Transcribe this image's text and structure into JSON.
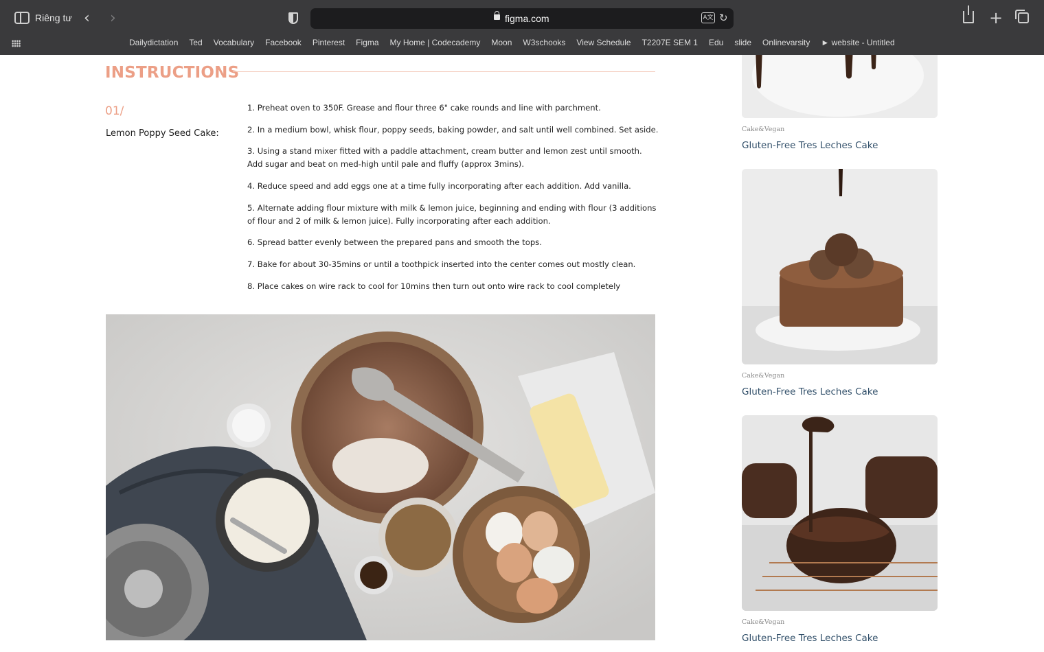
{
  "browser": {
    "profile_label": "Riêng tư",
    "url": "figma.com",
    "bookmarks": [
      "Dailydictation",
      "Ted",
      "Vocabulary",
      "Facebook",
      "Pinterest",
      "Figma",
      "My Home | Codecademy",
      "Moon",
      "W3schooks",
      "View Schedule",
      "T2207E SEM 1",
      "Edu",
      "slide",
      "Onlinevarsity",
      "► website - Untitled"
    ]
  },
  "instructions": {
    "title": "INSTRUCTIONS",
    "step_number": "01/",
    "step_heading": "Lemon Poppy Seed Cake:",
    "steps": [
      "1. Preheat oven to 350F. Grease and flour three 6\" cake rounds and line with parchment.",
      "2. In a medium bowl, whisk flour, poppy seeds, baking powder, and salt until well combined. Set aside.",
      "3. Using a stand mixer fitted with a paddle attachment, cream butter and lemon zest until smooth. Add sugar and beat on med-high until pale and fluffy (approx 3mins).",
      "4. Reduce speed and add eggs one at a time fully incorporating after each addition. Add vanilla.",
      "5. Alternate adding flour mixture with milk & lemon juice, beginning and ending with flour (3 additions of flour and 2 of milk & lemon juice). Fully incorporating after each addition.",
      "6. Spread batter evenly between the prepared pans and smooth the tops.",
      "7. Bake for about 30-35mins or until a toothpick inserted into the center comes out mostly clean.",
      "8. Place cakes on wire rack to cool for 10mins then turn out onto wire rack to cool completely"
    ]
  },
  "sidebar": {
    "cards": [
      {
        "category": "Cake&Vegan",
        "title": "Gluten-Free Tres Leches Cake"
      },
      {
        "category": "Cake&Vegan",
        "title": "Gluten-Free Tres Leches Cake"
      },
      {
        "category": "Cake&Vegan",
        "title": "Gluten-Free Tres Leches Cake"
      }
    ]
  },
  "colors": {
    "accent": "#ec9f86",
    "link": "#32506a",
    "chrome": "#3a3a3c"
  }
}
